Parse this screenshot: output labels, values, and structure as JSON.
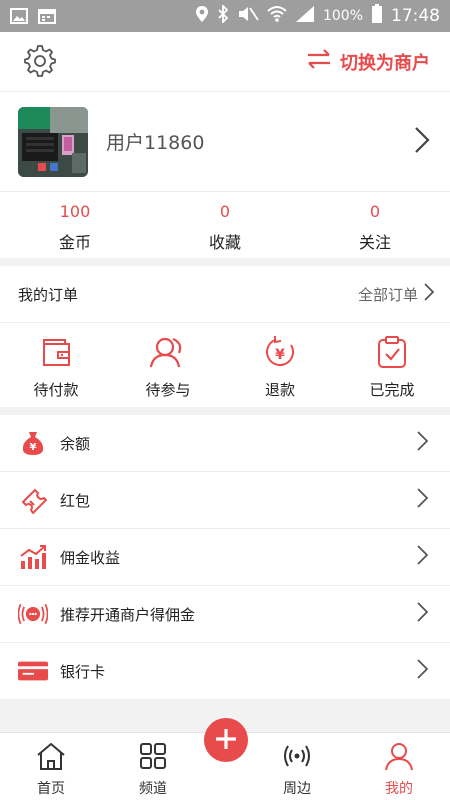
{
  "status_bar": {
    "battery": "100%",
    "time": "17:48"
  },
  "topbar": {
    "switch_label": "切换为商户"
  },
  "profile": {
    "username": "用户11860"
  },
  "stats": [
    {
      "value": "100",
      "label": "金币"
    },
    {
      "value": "0",
      "label": "收藏"
    },
    {
      "value": "0",
      "label": "关注"
    }
  ],
  "orders": {
    "title": "我的订单",
    "all_label": "全部订单",
    "items": [
      {
        "label": "待付款",
        "icon": "wallet-icon"
      },
      {
        "label": "待参与",
        "icon": "user-icon"
      },
      {
        "label": "退款",
        "icon": "refund-icon"
      },
      {
        "label": "已完成",
        "icon": "clipboard-check-icon"
      }
    ]
  },
  "menu": [
    {
      "label": "余额",
      "icon": "money-bag-icon"
    },
    {
      "label": "红包",
      "icon": "ticket-icon"
    },
    {
      "label": "佣金收益",
      "icon": "bar-chart-icon"
    },
    {
      "label": "推荐开通商户得佣金",
      "icon": "broadcast-chat-icon"
    },
    {
      "label": "银行卡",
      "icon": "card-icon"
    }
  ],
  "tabbar": [
    {
      "label": "首页",
      "icon": "home-icon"
    },
    {
      "label": "频道",
      "icon": "grid-icon"
    },
    {
      "label": "周边",
      "icon": "nearby-icon"
    },
    {
      "label": "我的",
      "icon": "profile-icon"
    }
  ],
  "colors": {
    "accent": "#e84b4b",
    "background": "#f2f2f2"
  }
}
